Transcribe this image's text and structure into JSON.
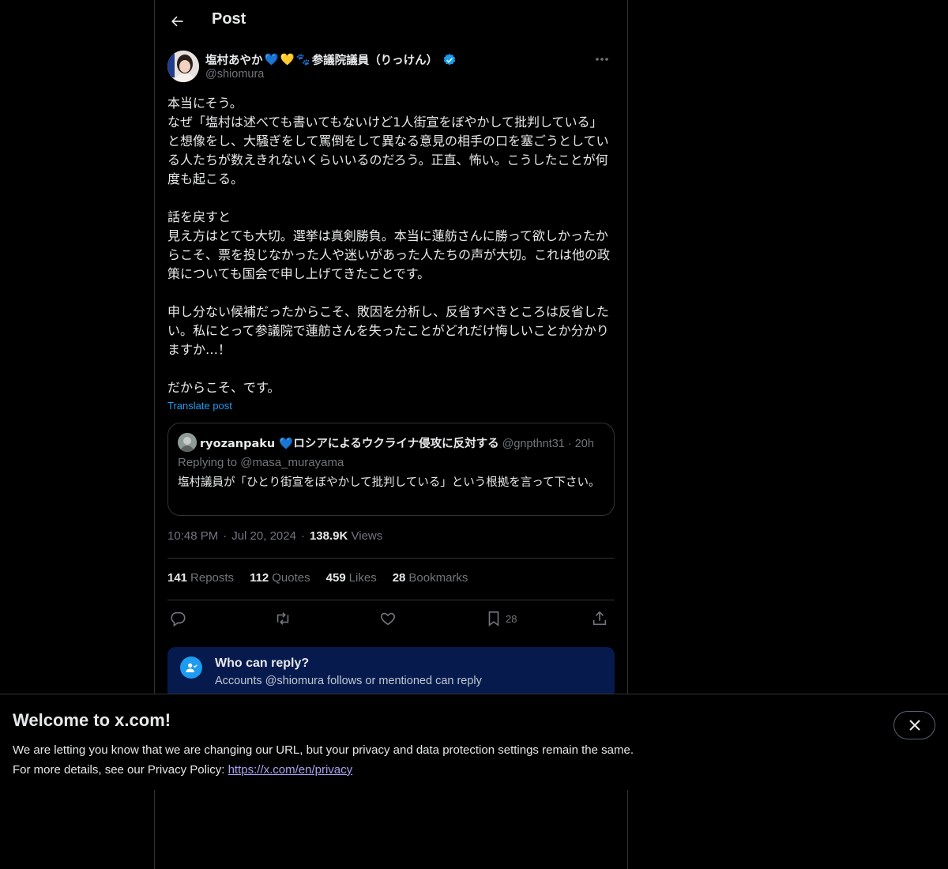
{
  "header": {
    "title": "Post",
    "back_icon": "arrow-left-icon"
  },
  "author": {
    "display_name": "塩村あやか",
    "emoji": [
      "💙",
      "💛",
      "🐾"
    ],
    "title_suffix": "参議院議員（りっけん）",
    "handle": "@shiomura",
    "verified": true
  },
  "post": {
    "text": "本当にそう。\nなぜ「塩村は述べても書いてもないけど1人街宣をぼやかして批判している」と想像をし、大騒ぎをして罵倒をして異なる意見の相手の口を塞ごうとしている人たちが数えきれないくらいいるのだろう。正直、怖い。こうしたことが何度も起こる。\n\n話を戻すと\n見え方はとても大切。選挙は真剣勝負。本当に蓮舫さんに勝って欲しかったからこそ、票を投じなかった人や迷いがあった人たちの声が大切。これは他の政策についても国会で申し上げてきたことです。\n\n申し分ない候補だったからこそ、敗因を分析し、反省すべきところは反省したい。私にとって参議院で蓮舫さんを失ったことがどれだけ悔しいことか分かりますか…！\n\nだからこそ、です。",
    "translate_label": "Translate post"
  },
  "quote": {
    "name": "ryozanpaku 💙ロシアによるウクライナ侵攻に反対する",
    "handle": "@gnpthnt31",
    "separator": "·",
    "time": "20h",
    "replying_to": "Replying to @masa_murayama",
    "text": "塩村議員が「ひとり街宣をぼやかして批判している」という根拠を言って下さい。"
  },
  "meta": {
    "time": "10:48 PM",
    "dot": "·",
    "date": "Jul 20, 2024",
    "views_count": "138.9K",
    "views_label": "Views"
  },
  "stats": [
    {
      "count": "141",
      "label": "Reposts"
    },
    {
      "count": "112",
      "label": "Quotes"
    },
    {
      "count": "459",
      "label": "Likes"
    },
    {
      "count": "28",
      "label": "Bookmarks"
    }
  ],
  "actions": {
    "reply_icon": "reply-icon",
    "repost_icon": "repost-icon",
    "like_icon": "heart-icon",
    "bookmark_icon": "bookmark-icon",
    "bookmark_count": "28",
    "share_icon": "share-icon"
  },
  "who_can_reply": {
    "title": "Who can reply?",
    "subtitle": "Accounts @shiomura follows or mentioned can reply"
  },
  "banner": {
    "title": "Welcome to x.com!",
    "line1": "We are letting you know that we are changing our URL, but your privacy and data protection settings remain the same.",
    "line2_prefix": "For more details, see our Privacy Policy: ",
    "link": "https://x.com/en/privacy"
  },
  "colors": {
    "accent": "#1d9bf0",
    "background": "#000000",
    "muted": "#71767b",
    "border": "#2f3336"
  }
}
